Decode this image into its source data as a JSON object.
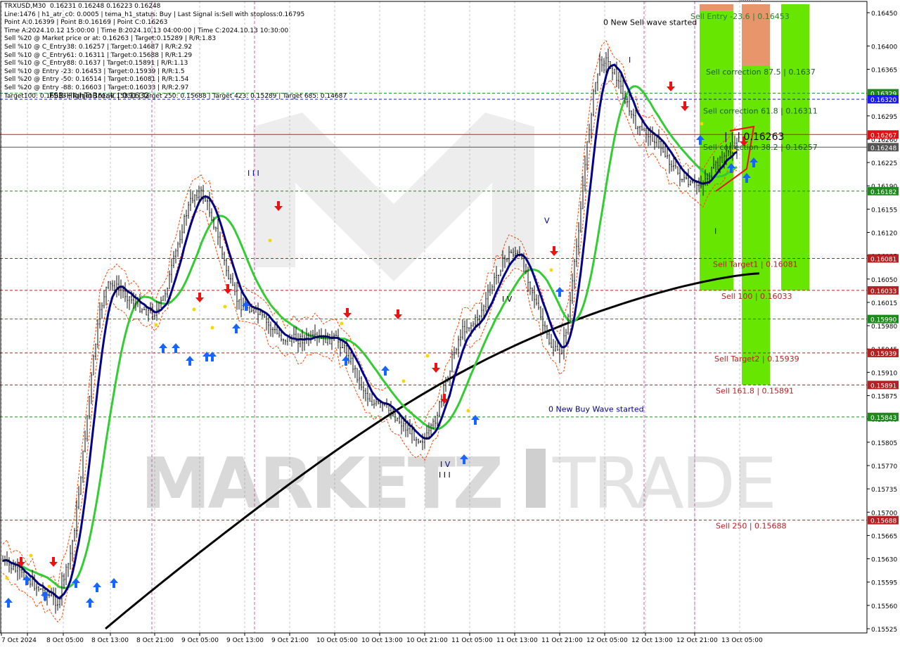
{
  "info_lines": [
    "TRXUSD,M30  0.16231 0.16248 0.16223 0.16248",
    "Line:1476 | h1_atr_c0: 0.0005 | tema_h1_status: Buy | Last Signal is:Sell with stoploss:0.16795",
    "Point A:0.16399 | Point B:0.16169 | Point C:0.16263",
    "Time A:2024.10.12 15:00:00 | Time B:2024.10.13 04:00:00 | Time C:2024.10.13 10:30:00",
    "Sell %20 @ Market price or at: 0.16263 | Target:0.15289 | R/R:1.83",
    "Sell %10 @ C_Entry38: 0.16257 | Target:0.14687 | R/R:2.92",
    "Sell %10 @ C_Entry61: 0.16311 | Target:0.15688 | R/R:1.29",
    "Sell %10 @ C_Entry88: 0.1637 | Target:0.15891 | R/R:1.13",
    "Sell %10 @ Entry -23: 0.16453 | Target:0.15939 | R/R:1.5",
    "Sell %20 @ Entry -50: 0.16514 | Target:0.16081 | R/R:1.54",
    "Sell %20 @ Entry -88: 0.16603 | Target:0.16033 | R/R:2.97",
    "Target100: 0.16033 | Target 161: 0.15891 | Target 250: 0.15688 | Target 423: 0.15289 | Target 685: 0.14687"
  ],
  "chart_data": {
    "type": "candlestick",
    "symbol": "TRXUSD",
    "timeframe": "M30",
    "ylim": [
      0.1551,
      0.1646
    ],
    "y_ticks": [
      "0.16450",
      "0.16400",
      "0.16365",
      "0.16295",
      "0.16260",
      "0.16225",
      "0.16190",
      "0.16155",
      "0.16120",
      "0.16085",
      "0.16050",
      "0.16015",
      "0.15980",
      "0.15945",
      "0.15910",
      "0.15875",
      "0.15840",
      "0.15805",
      "0.15770",
      "0.15735",
      "0.15700",
      "0.15665",
      "0.15630",
      "0.15595",
      "0.15560",
      "0.15525"
    ],
    "x_ticks": [
      "7 Oct 2024",
      "8 Oct 05:00",
      "8 Oct 13:00",
      "8 Oct 21:00",
      "9 Oct 05:00",
      "9 Oct 13:00",
      "9 Oct 21:00",
      "10 Oct 05:00",
      "10 Oct 13:00",
      "10 Oct 21:00",
      "11 Oct 05:00",
      "11 Oct 13:00",
      "11 Oct 21:00",
      "12 Oct 05:00",
      "12 Oct 13:00",
      "12 Oct 21:00",
      "13 Oct 05:00"
    ],
    "price_levels": [
      {
        "price": 0.16329,
        "label": "0.16329",
        "color": "#1e8a1e",
        "style": "dashed"
      },
      {
        "price": 0.1632,
        "label": "0.16320",
        "color": "#1a1aff",
        "style": "dashed"
      },
      {
        "price": 0.16267,
        "label": "0.16267",
        "color": "#dd1111",
        "style": "solid"
      },
      {
        "price": 0.16248,
        "label": "0.16248",
        "color": "#555555",
        "style": "solid"
      },
      {
        "price": 0.16182,
        "label": "0.16182",
        "color": "#1e8a1e",
        "style": "dashed"
      },
      {
        "price": 0.16081,
        "label": "0.16081",
        "color": "#b22222",
        "style": "dashed"
      },
      {
        "price": 0.16033,
        "label": "0.16033",
        "color": "#b22222",
        "style": "dashed"
      },
      {
        "price": 0.1599,
        "label": "0.15990",
        "color": "#1e8a1e",
        "style": "dashed"
      },
      {
        "price": 0.15939,
        "label": "0.15939",
        "color": "#b22222",
        "style": "dashed"
      },
      {
        "price": 0.15891,
        "label": "0.15891",
        "color": "#b22222",
        "style": "dashed"
      },
      {
        "price": 0.15843,
        "label": "0.15843",
        "color": "#1e8a1e",
        "style": "dashed"
      },
      {
        "price": 0.15688,
        "label": "0.15688",
        "color": "#b22222",
        "style": "dashed"
      }
    ],
    "zone_labels": [
      {
        "text": "Sell Entry -23.6 | 0.16453",
        "price": 0.16453,
        "color": "#2e7d32"
      },
      {
        "text": "Sell correction 87.5 | 0.1637",
        "price": 0.1637,
        "color": "#1b5e20"
      },
      {
        "text": "Sell correction 61.8 | 0.16311",
        "price": 0.16311,
        "color": "#1b5e20"
      },
      {
        "text": "| | | 0.16263",
        "price": 0.16263,
        "color": "#000000"
      },
      {
        "text": "Sell correction 38.2 | 0.16257",
        "price": 0.16257,
        "color": "#1b5e20"
      },
      {
        "text": "Sell Target1 | 0.16081",
        "price": 0.16081,
        "color": "#b22222"
      },
      {
        "text": "Sell 100 | 0.16033",
        "price": 0.16033,
        "color": "#b22222"
      },
      {
        "text": "Sell Target2 | 0.15939",
        "price": 0.15939,
        "color": "#b22222"
      },
      {
        "text": "Sell 161.8 | 0.15891",
        "price": 0.15891,
        "color": "#b22222"
      },
      {
        "text": "Sell 250 | 0.15688",
        "price": 0.15688,
        "color": "#b22222"
      }
    ],
    "annotations": [
      {
        "text": "0 New Sell wave started",
        "price": 0.16436,
        "color": "#000000"
      },
      {
        "text": "0 New Buy Wave started",
        "price": 0.15855,
        "color": "#00008b"
      },
      {
        "text": "FSB-HighToBreak | 0.1632",
        "price": 0.16326,
        "color": "#000000"
      },
      {
        "text": "I I I",
        "price": 0.16209,
        "color": "#00008b"
      },
      {
        "text": "V",
        "price": 0.16138,
        "color": "#00008b"
      },
      {
        "text": "I V",
        "price": 0.15772,
        "color": "#00008b"
      },
      {
        "text": "I",
        "price": 0.16379,
        "color": "#00008b"
      },
      {
        "text": "I",
        "price": 0.16122,
        "color": "#000000"
      },
      {
        "text": "I V",
        "price": 0.1602,
        "color": "#000000"
      },
      {
        "text": "I I I",
        "price": 0.15756,
        "color": "#000000"
      }
    ],
    "key_points": [
      {
        "time": "8 Oct 05:00",
        "price": 0.1556
      },
      {
        "time": "8 Oct 13:00",
        "price": 0.156
      },
      {
        "time": "8 Oct 21:00",
        "price": 0.1604
      },
      {
        "time": "9 Oct 05:00",
        "price": 0.16
      },
      {
        "time": "9 Oct 13:00",
        "price": 0.1618
      },
      {
        "time": "9 Oct 21:00",
        "price": 0.1601
      },
      {
        "time": "10 Oct 05:00",
        "price": 0.1596
      },
      {
        "time": "10 Oct 13:00",
        "price": 0.1596
      },
      {
        "time": "10 Oct 21:00",
        "price": 0.1586
      },
      {
        "time": "11 Oct 05:00",
        "price": 0.1581
      },
      {
        "time": "11 Oct 13:00",
        "price": 0.1598
      },
      {
        "time": "11 Oct 21:00",
        "price": 0.1609
      },
      {
        "time": "12 Oct 05:00",
        "price": 0.1594
      },
      {
        "time": "12 Oct 13:00",
        "price": 0.1638
      },
      {
        "time": "12 Oct 21:00",
        "price": 0.1627
      },
      {
        "time": "13 Oct 05:00",
        "price": 0.1619
      },
      {
        "time": "13 Oct 10:30",
        "price": 0.16248
      }
    ],
    "grid": true
  },
  "watermark": "MARKETZ TRADE",
  "colors": {
    "bull_zone": "#66e600",
    "sell_entry_zone": "#e8956b",
    "ema_blue": "#00008b",
    "ema_green": "#33cc33",
    "ema_black": "#000000",
    "channel": "#ff4500",
    "buy_arrow": "#1565ff",
    "sell_arrow": "#ee1111"
  }
}
